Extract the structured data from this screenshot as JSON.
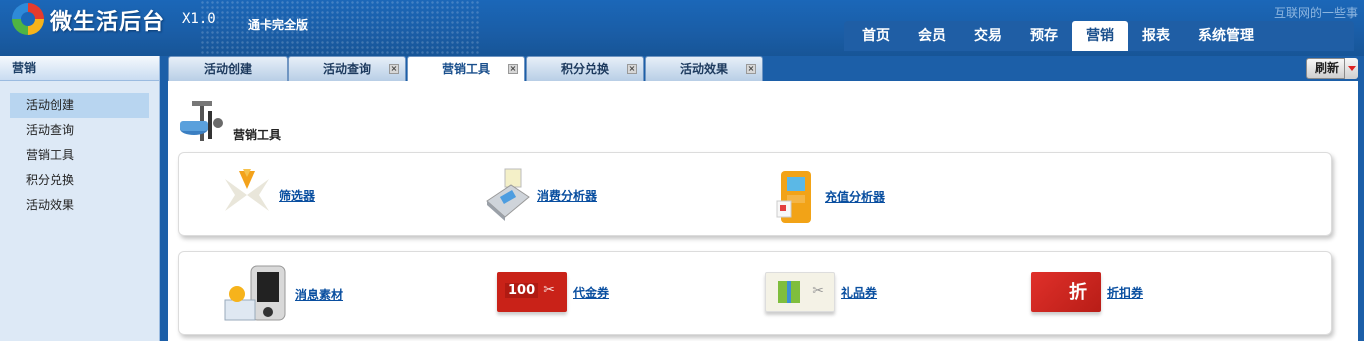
{
  "header": {
    "app_title": "微生活后台",
    "version": "X1.0",
    "edition": "通卡完全版",
    "slogan": "互联网的一些事",
    "nav": [
      {
        "label": "首页",
        "active": false
      },
      {
        "label": "会员",
        "active": false
      },
      {
        "label": "交易",
        "active": false
      },
      {
        "label": "预存",
        "active": false
      },
      {
        "label": "营销",
        "active": true
      },
      {
        "label": "报表",
        "active": false
      },
      {
        "label": "系统管理",
        "active": false
      }
    ]
  },
  "sidebar": {
    "title": "营销",
    "items": [
      {
        "label": "活动创建",
        "active": true
      },
      {
        "label": "活动查询",
        "active": false
      },
      {
        "label": "营销工具",
        "active": false
      },
      {
        "label": "积分兑换",
        "active": false
      },
      {
        "label": "活动效果",
        "active": false
      }
    ]
  },
  "tabs": [
    {
      "label": "活动创建",
      "closable": false,
      "active": false
    },
    {
      "label": "活动查询",
      "closable": true,
      "active": false
    },
    {
      "label": "营销工具",
      "closable": true,
      "active": true
    },
    {
      "label": "积分兑换",
      "closable": true,
      "active": false
    },
    {
      "label": "活动效果",
      "closable": true,
      "active": false
    }
  ],
  "toolbar": {
    "refresh_label": "刷新"
  },
  "main": {
    "section_title": "营销工具",
    "row1": [
      {
        "label": "筛选器",
        "icon": "filter-icon"
      },
      {
        "label": "消费分析器",
        "icon": "pos-terminal-icon"
      },
      {
        "label": "充值分析器",
        "icon": "atm-icon"
      }
    ],
    "row2": [
      {
        "label": "消息素材",
        "icon": "phone-message-icon"
      },
      {
        "label": "代金券",
        "icon": "voucher-icon",
        "badge": "100"
      },
      {
        "label": "礼品券",
        "icon": "gift-coupon-icon"
      },
      {
        "label": "折扣券",
        "icon": "discount-coupon-icon",
        "badge": "折"
      }
    ]
  },
  "colors": {
    "header_bg": "#1b67b8",
    "link": "#0a4fa0",
    "sidebar_bg": "#dde9f6"
  }
}
